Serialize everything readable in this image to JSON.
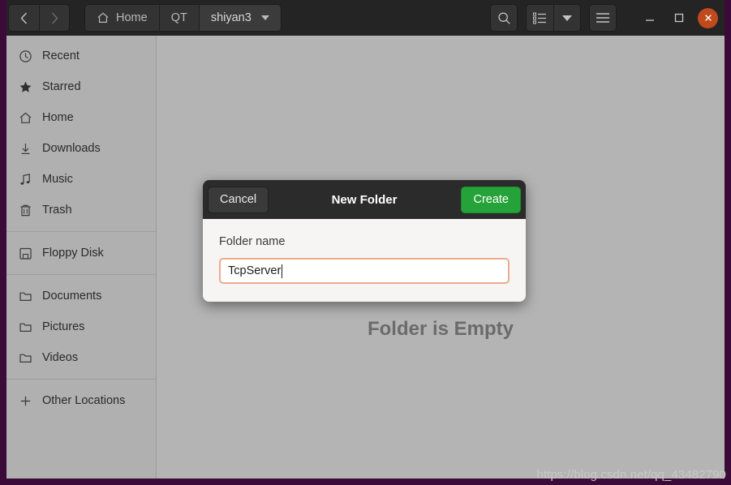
{
  "header": {
    "nav": {
      "back_icon": "chevron-left-icon",
      "forward_icon": "chevron-right-icon"
    },
    "breadcrumbs": [
      {
        "label": "Home",
        "icon": "home-icon",
        "active": false
      },
      {
        "label": "QT",
        "icon": "",
        "active": false
      },
      {
        "label": "shiyan3",
        "icon": "",
        "active": true
      }
    ],
    "actions": {
      "search_icon": "search-icon",
      "view_list_icon": "list-view-icon",
      "view_dropdown_icon": "chevron-down-icon",
      "menu_icon": "hamburger-menu-icon"
    },
    "window_controls": {
      "minimize": "—",
      "maximize": "▫",
      "close": "✕"
    }
  },
  "sidebar": {
    "groups": [
      {
        "items": [
          {
            "label": "Recent",
            "icon": "clock-icon"
          },
          {
            "label": "Starred",
            "icon": "star-icon"
          },
          {
            "label": "Home",
            "icon": "home-icon"
          },
          {
            "label": "Downloads",
            "icon": "download-icon"
          },
          {
            "label": "Music",
            "icon": "music-note-icon"
          },
          {
            "label": "Trash",
            "icon": "trash-icon"
          }
        ]
      },
      {
        "items": [
          {
            "label": "Floppy Disk",
            "icon": "floppy-disk-icon"
          }
        ]
      },
      {
        "items": [
          {
            "label": "Documents",
            "icon": "folder-icon"
          },
          {
            "label": "Pictures",
            "icon": "folder-icon"
          },
          {
            "label": "Videos",
            "icon": "folder-icon"
          }
        ]
      },
      {
        "items": [
          {
            "label": "Other Locations",
            "icon": "plus-icon"
          }
        ]
      }
    ]
  },
  "main": {
    "empty_message": "Folder is Empty"
  },
  "dialog": {
    "title": "New Folder",
    "cancel_label": "Cancel",
    "create_label": "Create",
    "field_label": "Folder name",
    "field_value": "TcpServer",
    "field_placeholder": "Folder name"
  },
  "watermark": {
    "text": "https://blog.csdn.net/qq_43482790"
  },
  "colors": {
    "desktop": "#3c0a38",
    "headerbar": "#242424",
    "sidebar": "#b0b0b0",
    "content": "#b4b4b4",
    "accent_green": "#26a338",
    "close_orange": "#c04a1c",
    "input_focus": "#eeab8c"
  }
}
